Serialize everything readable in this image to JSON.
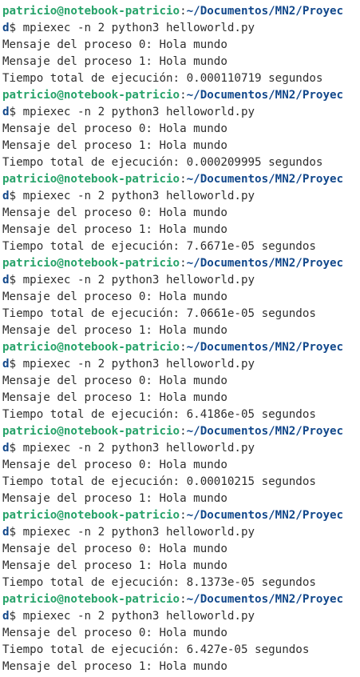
{
  "prompt": {
    "user_host": "patricio@notebook-patricio",
    "separator": ":",
    "path_part1": "~/Documentos/MN2/Proyec",
    "path_part2": "d",
    "symbol": "$ ",
    "command": "mpiexec -n 2 python3 helloworld.py"
  },
  "runs": [
    {
      "output": [
        "Mensaje del proceso 0: Hola mundo",
        "Mensaje del proceso 1: Hola mundo",
        "Tiempo total de ejecución: 0.000110719 segundos"
      ]
    },
    {
      "output": [
        "Mensaje del proceso 0: Hola mundo",
        "Mensaje del proceso 1: Hola mundo",
        "Tiempo total de ejecución: 0.000209995 segundos"
      ]
    },
    {
      "output": [
        "Mensaje del proceso 0: Hola mundo",
        "Mensaje del proceso 1: Hola mundo",
        "Tiempo total de ejecución: 7.6671e-05 segundos"
      ]
    },
    {
      "output": [
        "Mensaje del proceso 0: Hola mundo",
        "Tiempo total de ejecución: 7.0661e-05 segundos",
        "Mensaje del proceso 1: Hola mundo"
      ]
    },
    {
      "output": [
        "Mensaje del proceso 0: Hola mundo",
        "Mensaje del proceso 1: Hola mundo",
        "Tiempo total de ejecución: 6.4186e-05 segundos"
      ]
    },
    {
      "output": [
        "Mensaje del proceso 0: Hola mundo",
        "Tiempo total de ejecución: 0.00010215 segundos",
        "Mensaje del proceso 1: Hola mundo"
      ]
    },
    {
      "output": [
        "Mensaje del proceso 0: Hola mundo",
        "Mensaje del proceso 1: Hola mundo",
        "Tiempo total de ejecución: 8.1373e-05 segundos"
      ]
    },
    {
      "output": [
        "Mensaje del proceso 0: Hola mundo",
        "Tiempo total de ejecución: 6.427e-05 segundos",
        "Mensaje del proceso 1: Hola mundo"
      ]
    }
  ],
  "colors": {
    "user_host": "#26a269",
    "path": "#12488b",
    "text": "#2e2e2e",
    "background": "#ffffff"
  }
}
